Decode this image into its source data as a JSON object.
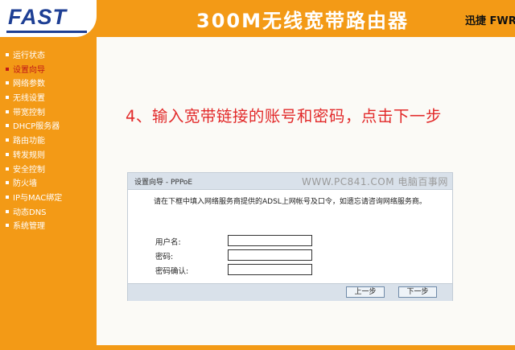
{
  "header": {
    "logo_text": "FAST",
    "product_title": "300M无线宽带路由器",
    "brand_right": "迅捷 FWR"
  },
  "sidebar": {
    "items": [
      {
        "label": "运行状态",
        "active": false
      },
      {
        "label": "设置向导",
        "active": true
      },
      {
        "label": "网络参数",
        "active": false
      },
      {
        "label": "无线设置",
        "active": false
      },
      {
        "label": "带宽控制",
        "active": false
      },
      {
        "label": "DHCP服务器",
        "active": false
      },
      {
        "label": "路由功能",
        "active": false
      },
      {
        "label": "转发规则",
        "active": false
      },
      {
        "label": "安全控制",
        "active": false
      },
      {
        "label": "防火墙",
        "active": false
      },
      {
        "label": "IP与MAC绑定",
        "active": false
      },
      {
        "label": "动态DNS",
        "active": false
      },
      {
        "label": "系统管理",
        "active": false
      }
    ]
  },
  "caption": "4、输入宽带链接的账号和密码，点击下一步",
  "panel": {
    "title": "设置向导 - PPPoE",
    "watermark": "WWW.PC841.COM 电脑百事网",
    "instructions": "请在下框中填入网络服务商提供的ADSL上网帐号及口令，如遗忘请咨询网络服务商。",
    "fields": {
      "username_label": "用户名:",
      "username_value": "",
      "password_label": "密码:",
      "password_value": "",
      "confirm_label": "密码确认:",
      "confirm_value": ""
    },
    "buttons": {
      "prev": "上一步",
      "next": "下一步"
    }
  },
  "colors": {
    "orange": "#f39a16",
    "logo_blue": "#1e3f94",
    "caption_red": "#e22a2a",
    "active_menu": "#c01818",
    "panel_bar": "#d9e1ea"
  }
}
